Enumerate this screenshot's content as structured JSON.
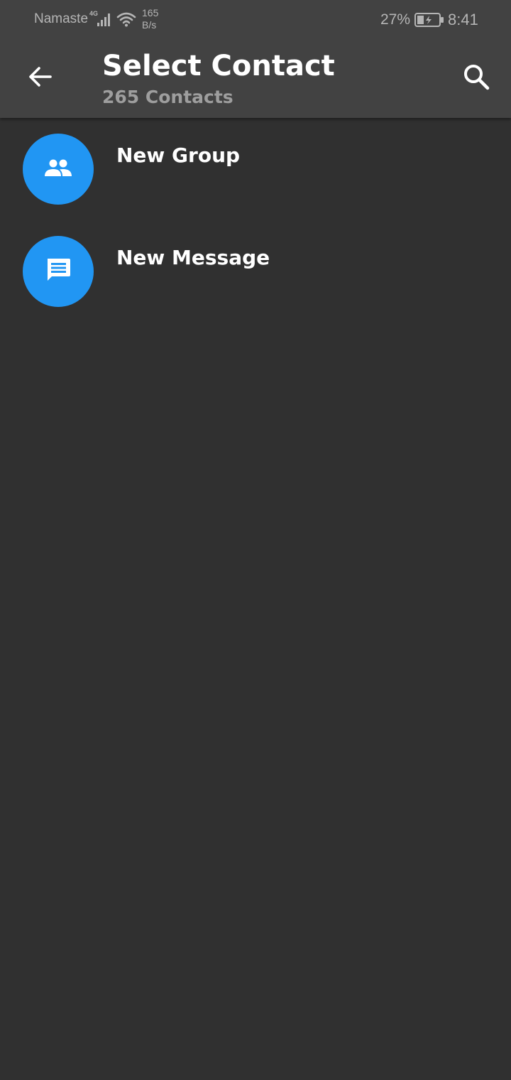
{
  "status_bar": {
    "carrier": "Namaste",
    "network_type": "4G",
    "speed_value": "165",
    "speed_unit": "B/s",
    "battery_percent": "27%",
    "time": "8:41"
  },
  "header": {
    "back_icon": "arrow-back-icon",
    "title": "Select Contact",
    "subtitle": "265 Contacts",
    "search_icon": "search-icon"
  },
  "menu": {
    "items": [
      {
        "label": "New Group",
        "icon": "group-icon"
      },
      {
        "label": "New Message",
        "icon": "message-icon"
      }
    ]
  },
  "colors": {
    "background": "#303030",
    "toolbar": "#424242",
    "accent": "#2196f3",
    "subtitle": "#9e9e9e"
  }
}
